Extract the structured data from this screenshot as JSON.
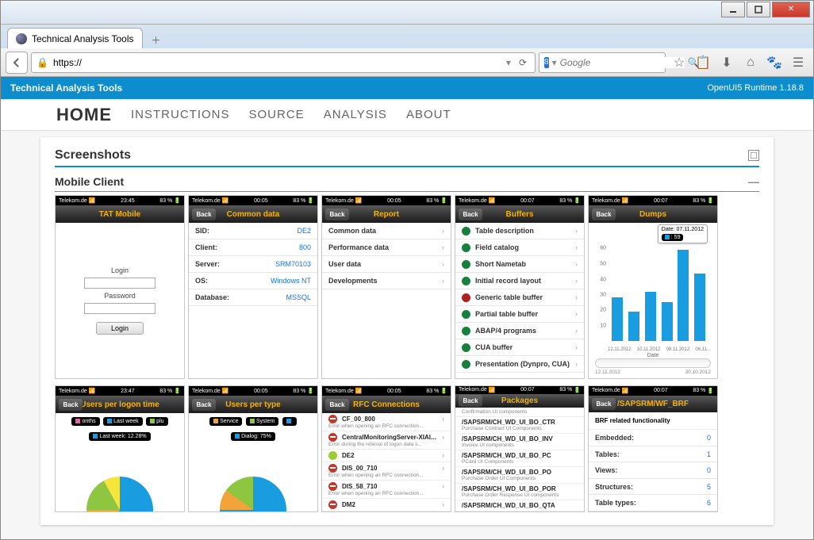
{
  "browser": {
    "tab_title": "Technical Analysis Tools",
    "url_scheme": "https://",
    "search_placeholder": "Google"
  },
  "banner": {
    "title": "Technical Analysis Tools",
    "runtime": "OpenUI5 Runtime 1.18.8"
  },
  "nav": {
    "home": "HOME",
    "instructions": "INSTRUCTIONS",
    "source": "SOURCE",
    "analysis": "ANALYSIS",
    "about": "ABOUT"
  },
  "sections": {
    "screenshots": "Screenshots",
    "mobile_client": "Mobile Client"
  },
  "statusbar": {
    "carrier": "Telekom.de",
    "time1": "23:45",
    "time2": "00:05",
    "time3": "00:05",
    "time4": "00:07",
    "time5": "00:07",
    "time6": "23:47",
    "time7": "00:05",
    "time8": "00:05",
    "time9": "00:07",
    "time10": "00:07",
    "battery": "83 %"
  },
  "back_label": "Back",
  "shot1": {
    "title": "TAT Mobile",
    "login_label": "Login",
    "password_label": "Password",
    "login_btn": "Login"
  },
  "shot2": {
    "title": "Common data",
    "rows": {
      "sid_k": "SID:",
      "sid_v": "DE2",
      "client_k": "Client:",
      "client_v": "800",
      "server_k": "Server:",
      "server_v": "SRM70103",
      "os_k": "OS:",
      "os_v": "Windows NT",
      "db_k": "Database:",
      "db_v": "MSSQL"
    }
  },
  "shot3": {
    "title": "Report",
    "items": {
      "a": "Common data",
      "b": "Performance data",
      "c": "User data",
      "d": "Developments"
    }
  },
  "shot4": {
    "title": "Buffers",
    "items": {
      "a": "Table description",
      "b": "Field catalog",
      "c": "Short Nametab",
      "d": "Initial record layout",
      "e": "Generic table buffer",
      "f": "Partial table buffer",
      "g": "ABAP/4 programs",
      "h": "CUA buffer",
      "i": "Presentation (Dynpro, CUA)"
    }
  },
  "shot5": {
    "title": "Dumps",
    "tooltip_date": "Date: 07.11.2012",
    "tooltip_val": ": 59",
    "xlabel": "Date",
    "range_start": "12.11.2012",
    "range_end": "30.10.2012"
  },
  "shot6": {
    "title": "Users per logon time",
    "legend": {
      "a": "onths",
      "b": "Last week",
      "c": "plu"
    },
    "hover": "Last week: 12.28%"
  },
  "shot7": {
    "title": "Users per type",
    "legend": {
      "a": "Service",
      "b": "System"
    },
    "hover": "Dialog: 75%"
  },
  "shot8": {
    "title": "RFC Connections",
    "rows": {
      "a_t": "CF_00_800",
      "a_s": "Error when opening an RFC connection...",
      "b_t": "CentralMonitoringServer-XIAl...",
      "b_s": "Error during the retieval of logon data s...",
      "c_t": "DE2",
      "c_s": "",
      "d_t": "DIS_00_710",
      "d_s": "Error when opening an RFC connection...",
      "e_t": "DIS_58_710",
      "e_s": "Error when opening an RFC connection...",
      "f_t": "DM2",
      "f_s": ""
    }
  },
  "shot9": {
    "title": "Packages",
    "rows": {
      "a_t": "/SAPSRM/CH_WD_UI_BO_CTR",
      "a_s": "Purchase Contract UI Components",
      "b_t": "/SAPSRM/CH_WD_UI_BO_INV",
      "b_s": "Invoice UI components",
      "c_t": "/SAPSRM/CH_WD_UI_BO_PC",
      "c_s": "PCard UI Components",
      "d_t": "/SAPSRM/CH_WD_UI_BO_PO",
      "d_s": "Purchase Order UI Components",
      "e_t": "/SAPSRM/CH_WD_UI_BO_POR",
      "e_s": "Purchase Order Response UI components",
      "f_t": "/SAPSRM/CH_WD_UI_BO_QTA",
      "f_s": "",
      "top_s": "Confirmation UI components"
    }
  },
  "shot10": {
    "title": "/SAPSRM/WF_BRF",
    "desc": "BRF related functionality",
    "rows": {
      "a_k": "Embedded:",
      "a_v": "0",
      "b_k": "Tables:",
      "b_v": "1",
      "c_k": "Views:",
      "c_v": "0",
      "d_k": "Structures:",
      "d_v": "5",
      "e_k": "Table types:",
      "e_v": "6"
    }
  },
  "chart_data": {
    "type": "bar",
    "categories": [
      "12.11.2012",
      "10.11.2012",
      "08.11.2012",
      "06.11..."
    ],
    "values": [
      28,
      19,
      32,
      25,
      59,
      44
    ],
    "title": "Dumps",
    "xlabel": "Date",
    "ylim": [
      0,
      60
    ],
    "yticks": [
      10,
      20,
      30,
      40,
      50,
      60
    ],
    "highlight": {
      "date": "07.11.2012",
      "value": 59
    },
    "range": {
      "start": "12.11.2012",
      "end": "30.10.2012"
    }
  }
}
